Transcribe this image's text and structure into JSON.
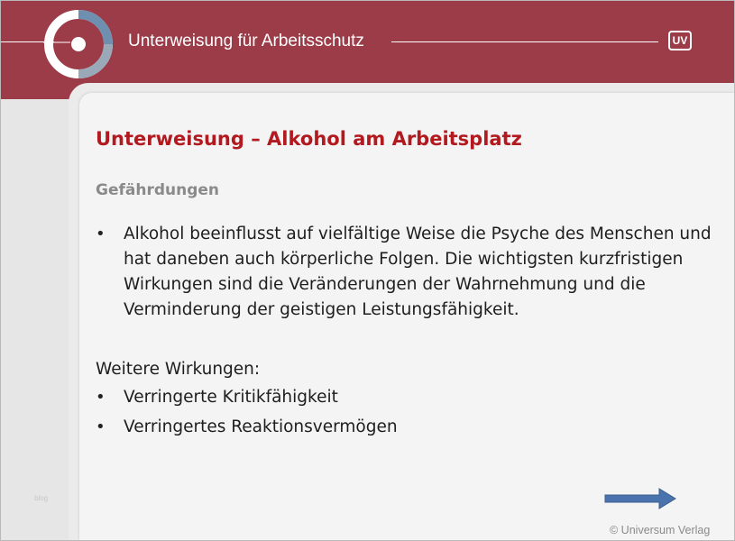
{
  "header": {
    "title": "Unterweisung für Arbeitsschutz",
    "badge": "UV",
    "logo_icon": "ring-logo-icon",
    "colors": {
      "header_bg": "#9b3c48",
      "logo_blue": "#6e8fb0",
      "title_red": "#b21a1f"
    }
  },
  "slide": {
    "title": "Unterweisung – Alkohol am Arbeitsplatz",
    "section_heading": "Gefährdungen",
    "bullet_symbol": "•",
    "paragraph": "Alkohol beeinflusst auf vielfältige Weise die Psyche des Menschen und hat daneben auch körperliche Folgen. Die wichtigsten kurzfristigen Wirkungen sind die Veränderungen der Wahrnehmung und die Verminderung der geistigen Leistungsfähigkeit.",
    "further_label": "Weitere Wirkungen:",
    "further_items": [
      "Verringerte Kritikfähigkeit",
      "Verringertes Reaktionsvermögen"
    ]
  },
  "navigation": {
    "next_icon": "right-arrow-icon"
  },
  "side_mark": "blog",
  "footer": {
    "copyright": "© Universum Verlag"
  }
}
